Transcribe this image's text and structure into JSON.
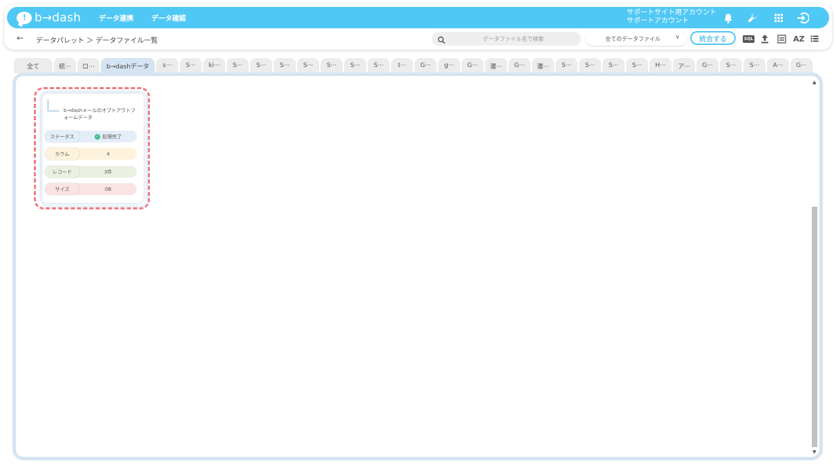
{
  "app": {
    "logo_text": "b→dash",
    "nav": [
      "データ連携",
      "データ確認"
    ],
    "account_line1": "サポートサイト用アカウント",
    "account_line2": "サポートアカウント"
  },
  "subbar": {
    "back_icon": "arrow-left-icon",
    "breadcrumb": "データパレット ＞ データファイル一覧",
    "search_placeholder": "データファイル名で検索",
    "filter_value": "全てのデータファイル",
    "merge_label": "統合する",
    "sql_label": "SQL",
    "sort_label": "AZ"
  },
  "tabs": [
    {
      "label": "全て",
      "active": false
    },
    {
      "label": "統···",
      "active": false
    },
    {
      "label": "ロ···",
      "active": false
    },
    {
      "label": "b→dashデータ",
      "active": true
    },
    {
      "label": "s···",
      "active": false
    },
    {
      "label": "S···",
      "active": false
    },
    {
      "label": "ki···",
      "active": false
    },
    {
      "label": "S···",
      "active": false
    },
    {
      "label": "S···",
      "active": false
    },
    {
      "label": "S···",
      "active": false
    },
    {
      "label": "S···",
      "active": false
    },
    {
      "label": "S···",
      "active": false
    },
    {
      "label": "S···",
      "active": false
    },
    {
      "label": "S···",
      "active": false
    },
    {
      "label": "t···",
      "active": false
    },
    {
      "label": "G···",
      "active": false
    },
    {
      "label": "g···",
      "active": false
    },
    {
      "label": "G···",
      "active": false
    },
    {
      "label": "連···",
      "active": false
    },
    {
      "label": "G···",
      "active": false
    },
    {
      "label": "連···",
      "active": false
    },
    {
      "label": "S···",
      "active": false
    },
    {
      "label": "S···",
      "active": false
    },
    {
      "label": "S···",
      "active": false
    },
    {
      "label": "S···",
      "active": false
    },
    {
      "label": "H···",
      "active": false
    },
    {
      "label": "ア···",
      "active": false
    },
    {
      "label": "G···",
      "active": false
    },
    {
      "label": "S···",
      "active": false
    },
    {
      "label": "S···",
      "active": false
    },
    {
      "label": "A···",
      "active": false
    },
    {
      "label": "G···",
      "active": false
    }
  ],
  "file_card": {
    "title": "b→dashメールのオプトアウトフォームデータ",
    "rows": [
      {
        "label": "ステータス",
        "value": "処理完了",
        "color": "#e3eef8"
      },
      {
        "label": "カラム",
        "value": "4",
        "color": "#fdf3dc"
      },
      {
        "label": "レコード",
        "value": "3件",
        "color": "#eaf1e2"
      },
      {
        "label": "サイズ",
        "value": "0B",
        "color": "#fbe3e4"
      }
    ]
  },
  "colors": {
    "accent": "#50c8f5",
    "panel_border": "#d4e4f2",
    "highlight": "#ee7b82",
    "status_ok": "#3bbf8a"
  }
}
